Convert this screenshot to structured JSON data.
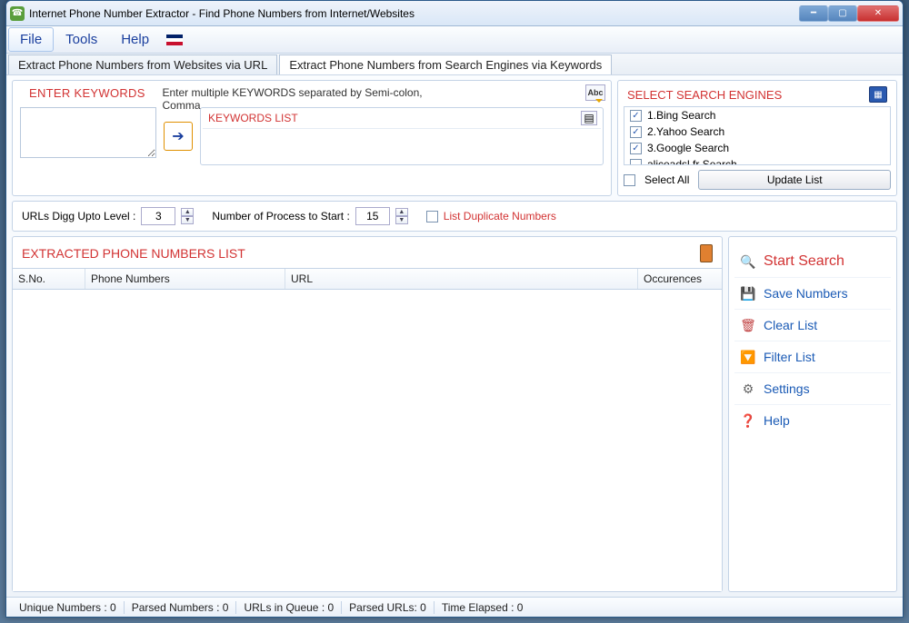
{
  "titlebar": {
    "text": "Internet Phone Number Extractor - Find Phone Numbers from Internet/Websites"
  },
  "menubar": {
    "file": "File",
    "tools": "Tools",
    "help": "Help"
  },
  "tabs": {
    "url": "Extract Phone Numbers from Websites via URL",
    "kw": "Extract Phone Numbers from Search Engines via Keywords"
  },
  "keywords_panel": {
    "title": "ENTER KEYWORDS",
    "hint": "Enter multiple KEYWORDS separated by Semi-colon, Comma",
    "abc": "Abc",
    "list_title": "KEYWORDS LIST"
  },
  "options": {
    "digg_label": "URLs Digg Upto Level :",
    "digg_value": "3",
    "proc_label": "Number of Process to Start :",
    "proc_value": "15",
    "dup_label": "List Duplicate Numbers"
  },
  "search_engines": {
    "title": "SELECT SEARCH ENGINES",
    "items": [
      {
        "label": "1.Bing Search",
        "checked": true
      },
      {
        "label": "2.Yahoo Search",
        "checked": true
      },
      {
        "label": "3.Google Search",
        "checked": true
      },
      {
        "label": "aliceadsl.fr Search",
        "checked": false
      }
    ],
    "select_all": "Select All",
    "update": "Update List"
  },
  "results": {
    "title": "EXTRACTED PHONE NUMBERS LIST",
    "cols": {
      "sno": "S.No.",
      "pn": "Phone Numbers",
      "url": "URL",
      "occ": "Occurences"
    }
  },
  "actions": {
    "start": "Start Search",
    "save": "Save Numbers",
    "clear": "Clear List",
    "filter": "Filter List",
    "settings": "Settings",
    "help": "Help"
  },
  "status": {
    "unique": "Unique Numbers :  0",
    "parsed": "Parsed Numbers :  0",
    "queue": "URLs in Queue :  0",
    "purls": "Parsed URLs:  0",
    "time": "Time Elapsed :  0"
  }
}
